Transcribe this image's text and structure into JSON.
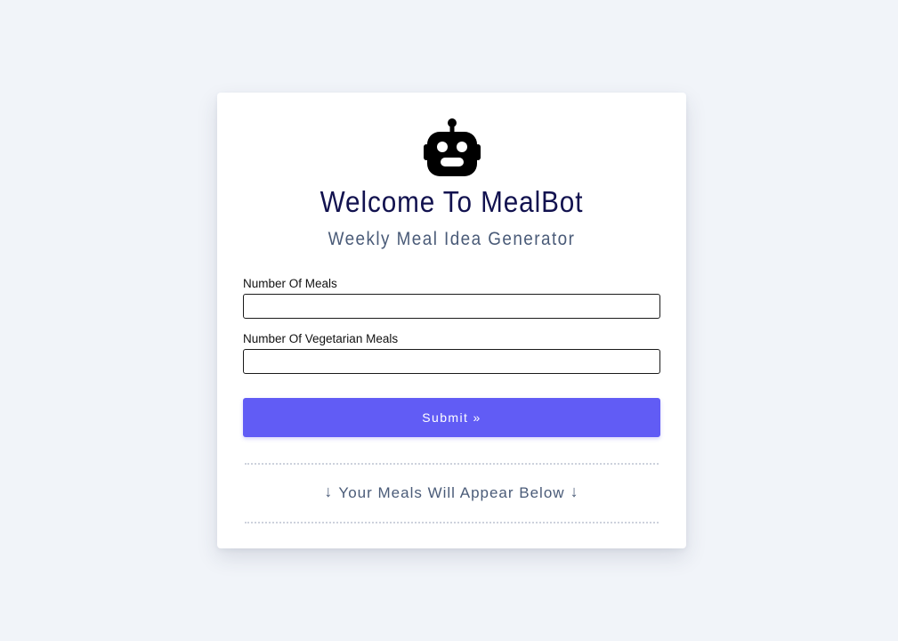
{
  "app": {
    "title": "Welcome To MealBot",
    "subtitle": "Weekly Meal Idea Generator",
    "logo_icon": "robot-icon"
  },
  "form": {
    "meals_label": "Number Of Meals",
    "meals_value": "",
    "veg_label": "Number Of Vegetarian Meals",
    "veg_value": "",
    "submit_label": "Submit »"
  },
  "results": {
    "arrow_left": "↓",
    "note": "Your Meals Will Appear Below",
    "arrow_right": "↓",
    "arrow_icon": "arrow-down-icon"
  },
  "colors": {
    "background": "#f1f4f9",
    "title": "#12124f",
    "subtitle": "#4a5b78",
    "button": "#615cf5",
    "divider": "#cdd2dc"
  }
}
